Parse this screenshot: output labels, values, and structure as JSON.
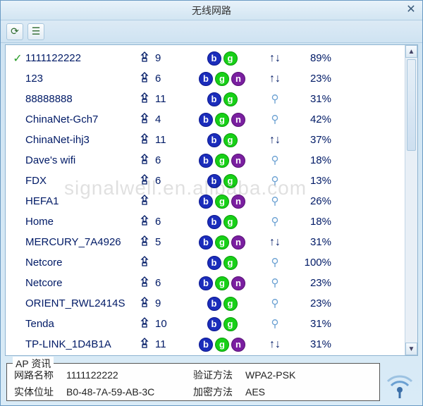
{
  "window": {
    "title": "无线网路"
  },
  "networks": [
    {
      "connected": true,
      "ssid": "1111122222",
      "lock": true,
      "channel": "9",
      "modes": [
        "b",
        "g"
      ],
      "sig": "arrows",
      "pct": "89%"
    },
    {
      "connected": false,
      "ssid": "123",
      "lock": true,
      "channel": "6",
      "modes": [
        "b",
        "g",
        "n"
      ],
      "sig": "arrows",
      "pct": "23%"
    },
    {
      "connected": false,
      "ssid": "88888888",
      "lock": true,
      "channel": "11",
      "modes": [
        "b",
        "g"
      ],
      "sig": "key",
      "pct": "31%"
    },
    {
      "connected": false,
      "ssid": "ChinaNet-Gch7",
      "lock": true,
      "channel": "4",
      "modes": [
        "b",
        "g",
        "n"
      ],
      "sig": "key",
      "pct": "42%"
    },
    {
      "connected": false,
      "ssid": "ChinaNet-ihj3",
      "lock": true,
      "channel": "11",
      "modes": [
        "b",
        "g"
      ],
      "sig": "arrows",
      "pct": "37%"
    },
    {
      "connected": false,
      "ssid": "Dave's wifi",
      "lock": true,
      "channel": "6",
      "modes": [
        "b",
        "g",
        "n"
      ],
      "sig": "key",
      "pct": "18%"
    },
    {
      "connected": false,
      "ssid": "FDX",
      "lock": true,
      "channel": "6",
      "modes": [
        "b",
        "g"
      ],
      "sig": "key",
      "pct": "13%"
    },
    {
      "connected": false,
      "ssid": "HEFA1",
      "lock": true,
      "channel": "",
      "modes": [
        "b",
        "g",
        "n"
      ],
      "sig": "key",
      "pct": "26%"
    },
    {
      "connected": false,
      "ssid": "Home",
      "lock": true,
      "channel": "6",
      "modes": [
        "b",
        "g"
      ],
      "sig": "key",
      "pct": "18%"
    },
    {
      "connected": false,
      "ssid": "MERCURY_7A4926",
      "lock": true,
      "channel": "5",
      "modes": [
        "b",
        "g",
        "n"
      ],
      "sig": "arrows",
      "pct": "31%"
    },
    {
      "connected": false,
      "ssid": "Netcore",
      "lock": true,
      "channel": "",
      "modes": [
        "b",
        "g"
      ],
      "sig": "key",
      "pct": "100%"
    },
    {
      "connected": false,
      "ssid": "Netcore",
      "lock": true,
      "channel": "6",
      "modes": [
        "b",
        "g",
        "n"
      ],
      "sig": "key",
      "pct": "23%"
    },
    {
      "connected": false,
      "ssid": "ORIENT_RWL2414S",
      "lock": true,
      "channel": "9",
      "modes": [
        "b",
        "g"
      ],
      "sig": "key",
      "pct": "23%"
    },
    {
      "connected": false,
      "ssid": "Tenda",
      "lock": true,
      "channel": "10",
      "modes": [
        "b",
        "g"
      ],
      "sig": "key",
      "pct": "31%"
    },
    {
      "connected": false,
      "ssid": "TP-LINK_1D4B1A",
      "lock": true,
      "channel": "11",
      "modes": [
        "b",
        "g",
        "n"
      ],
      "sig": "arrows",
      "pct": "31%"
    }
  ],
  "info": {
    "title": "AP 资讯",
    "name_label": "网路名称",
    "name_value": "1111122222",
    "auth_label": "验证方法",
    "auth_value": "WPA2-PSK",
    "mac_label": "实体位址",
    "mac_value": "B0-48-7A-59-AB-3C",
    "enc_label": "加密方法",
    "enc_value": "AES"
  },
  "watermark": "signalwell.en.alibaba.com"
}
